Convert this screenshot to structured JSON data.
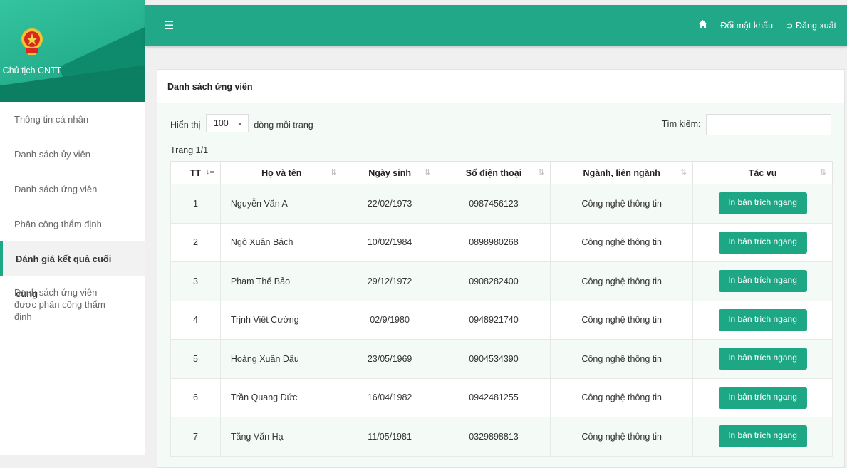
{
  "brand": {
    "title": "Chủ tịch CNTT"
  },
  "topbar": {
    "menu_icon": "hamburger-icon",
    "home_icon": "home-icon",
    "change_password": "Đổi mật khẩu",
    "logout": "Đăng xuất",
    "logout_icon": "sign-out-icon"
  },
  "sidebar": {
    "items": [
      {
        "label": "Thông tin cá nhân"
      },
      {
        "label": "Danh sách ủy viên"
      },
      {
        "label": "Danh sách ứng viên"
      },
      {
        "label": "Phân công thẩm định"
      },
      {
        "label": "Đánh giá kết quả cuối cùng",
        "active": true
      },
      {
        "label": "Danh sách ứng viên được phân công thẩm định"
      }
    ]
  },
  "panel": {
    "title": "Danh sách ứng viên",
    "length_prefix": "Hiển thị",
    "length_value": "100",
    "length_suffix": "dòng mỗi trang",
    "search_label": "Tìm kiếm:",
    "search_value": "",
    "page_info": "Trang 1/1"
  },
  "table": {
    "columns": [
      "TT",
      "Họ và tên",
      "Ngày sinh",
      "Số điện thoại",
      "Ngành, liên ngành",
      "Tác vụ"
    ],
    "action_label": "In bản trích ngang",
    "rows": [
      {
        "tt": "1",
        "name": "Nguyễn Văn A",
        "dob": "22/02/1973",
        "phone": "0987456123",
        "field": "Công nghệ thông tin"
      },
      {
        "tt": "2",
        "name": "Ngô Xuân Bách",
        "dob": "10/02/1984",
        "phone": "0898980268",
        "field": "Công nghệ thông tin"
      },
      {
        "tt": "3",
        "name": "Phạm Thế Bảo",
        "dob": "29/12/1972",
        "phone": "0908282400",
        "field": "Công nghệ thông tin"
      },
      {
        "tt": "4",
        "name": "Trịnh Viết Cường",
        "dob": "02/9/1980",
        "phone": "0948921740",
        "field": "Công nghệ thông tin"
      },
      {
        "tt": "5",
        "name": "Hoàng Xuân Dậu",
        "dob": "23/05/1969",
        "phone": "0904534390",
        "field": "Công nghệ thông tin"
      },
      {
        "tt": "6",
        "name": "Trần Quang Đức",
        "dob": "16/04/1982",
        "phone": "0942481255",
        "field": "Công nghệ thông tin"
      },
      {
        "tt": "7",
        "name": "Tăng Văn Hạ",
        "dob": "11/05/1981",
        "phone": "0329898813",
        "field": "Công nghệ thông tin"
      }
    ]
  }
}
